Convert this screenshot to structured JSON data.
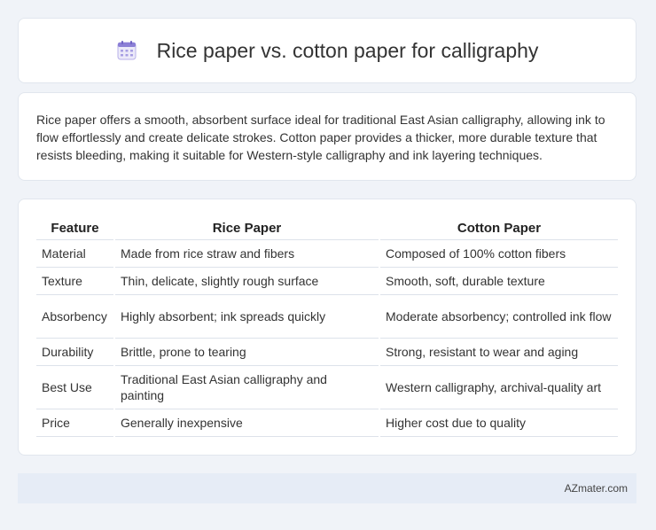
{
  "header": {
    "title": "Rice paper vs. cotton paper for calligraphy",
    "icon": "calendar-icon"
  },
  "intro": {
    "text": "Rice paper offers a smooth, absorbent surface ideal for traditional East Asian calligraphy, allowing ink to flow effortlessly and create delicate strokes. Cotton paper provides a thicker, more durable texture that resists bleeding, making it suitable for Western-style calligraphy and ink layering techniques."
  },
  "table": {
    "headers": [
      "Feature",
      "Rice Paper",
      "Cotton Paper"
    ],
    "rows": [
      [
        "Material",
        "Made from rice straw and fibers",
        "Composed of 100% cotton fibers"
      ],
      [
        "Texture",
        "Thin, delicate, slightly rough surface",
        "Smooth, soft, durable texture"
      ],
      [
        "Absorbency",
        "Highly absorbent; ink spreads quickly",
        "Moderate absorbency; controlled ink flow"
      ],
      [
        "Durability",
        "Brittle, prone to tearing",
        "Strong, resistant to wear and aging"
      ],
      [
        "Best Use",
        "Traditional East Asian calligraphy and painting",
        "Western calligraphy, archival-quality art"
      ],
      [
        "Price",
        "Generally inexpensive",
        "Higher cost due to quality"
      ]
    ]
  },
  "footer": {
    "brand": "AZmater.com"
  },
  "colors": {
    "page_background": "#f0f3f8",
    "card_background": "#ffffff",
    "footer_background": "#e6ecf6",
    "icon_accent": "#8b7fd6"
  }
}
